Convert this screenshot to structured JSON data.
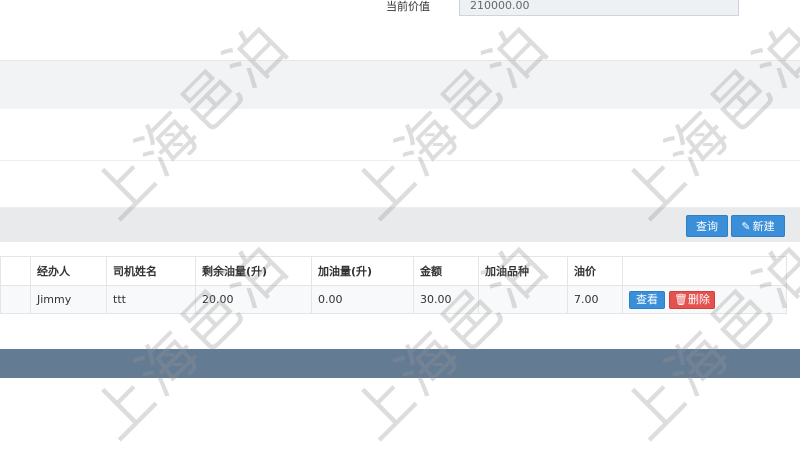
{
  "form": {
    "current_value_label": "当前价值",
    "current_value": "210000.00"
  },
  "toolbar": {
    "query_label": "查询",
    "new_label": "新建",
    "new_icon": "pencil-icon"
  },
  "table": {
    "headers": [
      "经办人",
      "司机姓名",
      "剩余油量(升)",
      "加油量(升)",
      "金额",
      "加油品种",
      "油价",
      ""
    ],
    "rows": [
      {
        "cells": [
          "Jimmy",
          "ttt",
          "20.00",
          "0.00",
          "30.00",
          "",
          "7.00"
        ],
        "view_label": "查看",
        "delete_label": "删除",
        "delete_icon": "trash-icon"
      }
    ]
  },
  "watermark_text": "上海邑泊",
  "colors": {
    "primary_button": "#3a8fd8",
    "danger_button": "#e4514f",
    "footer": "#647b94"
  }
}
